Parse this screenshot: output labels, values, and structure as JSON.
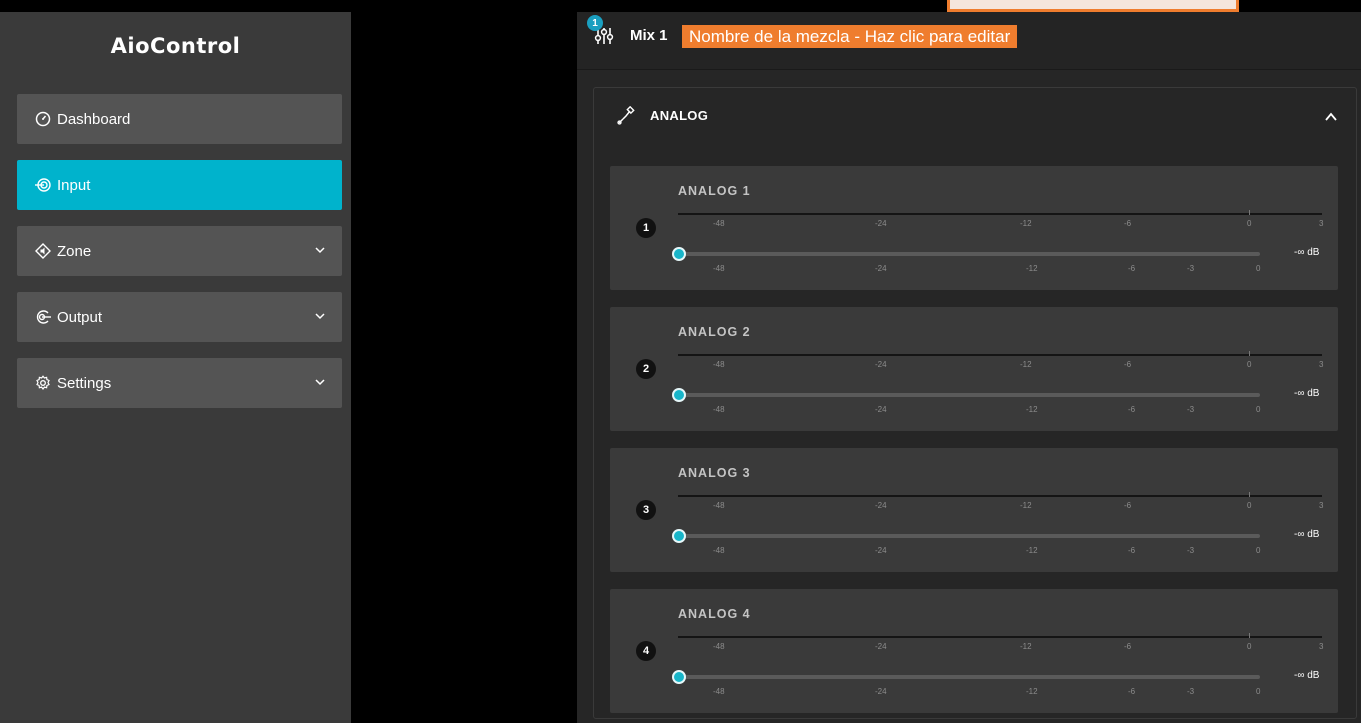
{
  "sidebar": {
    "logo": "AioControl",
    "items": [
      {
        "label": "Dashboard",
        "icon": "gauge-icon",
        "active": false,
        "expandable": false
      },
      {
        "label": "Input",
        "icon": "input-icon",
        "active": true,
        "expandable": false
      },
      {
        "label": "Zone",
        "icon": "speaker-icon",
        "active": false,
        "expandable": true
      },
      {
        "label": "Output",
        "icon": "output-icon",
        "active": false,
        "expandable": true
      },
      {
        "label": "Settings",
        "icon": "gear-icon",
        "active": false,
        "expandable": true
      }
    ]
  },
  "header": {
    "badge": "1",
    "mix_label": "Mix 1",
    "mix_name": "Nombre de la mezcla - Haz clic para editar"
  },
  "panel": {
    "title": "ANALOG",
    "channels": [
      {
        "number": "1",
        "name": "ANALOG 1",
        "level": "-∞ dB"
      },
      {
        "number": "2",
        "name": "ANALOG 2",
        "level": "-∞ dB"
      },
      {
        "number": "3",
        "name": "ANALOG 3",
        "level": "-∞ dB"
      },
      {
        "number": "4",
        "name": "ANALOG 4",
        "level": "-∞ dB"
      }
    ],
    "meter_scale": [
      "-48",
      "-24",
      "-12",
      "-6",
      "0",
      "3"
    ],
    "fader_scale": [
      "-48",
      "-24",
      "-12",
      "-6",
      "-3",
      "0"
    ]
  },
  "colors": {
    "accent": "#00b3cc",
    "mix_name_bg": "#ef7d2e",
    "sidebar_bg": "#3a3a3a",
    "nav_item_bg": "#545454",
    "main_bg": "#262626"
  }
}
